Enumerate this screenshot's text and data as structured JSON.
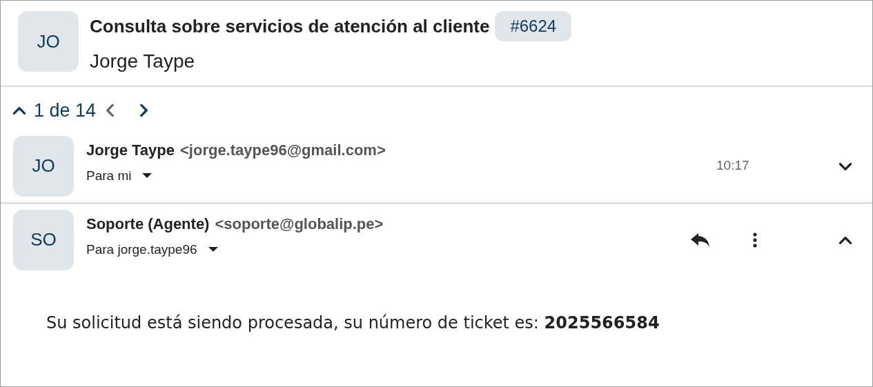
{
  "ticket": {
    "avatar": "JO",
    "subject": "Consulta sobre servicios de atención al cliente",
    "number": "#6624",
    "requester": "Jorge Taype"
  },
  "pager": {
    "text": "1 de 14",
    "prev_disabled": true,
    "next_disabled": false
  },
  "messages": [
    {
      "avatar": "JO",
      "sender": "Jorge Taype",
      "email": "<jorge.taype96@gmail.com>",
      "to": "Para mi",
      "time": "10:17",
      "expanded": false
    },
    {
      "avatar": "SO",
      "sender": "Soporte (Agente)",
      "email": "<soporte@globalip.pe>",
      "to": "Para jorge.taype96",
      "expanded": true,
      "body": "Su solicitud está siendo procesada, su número de ticket es: **2025566584**"
    }
  ]
}
